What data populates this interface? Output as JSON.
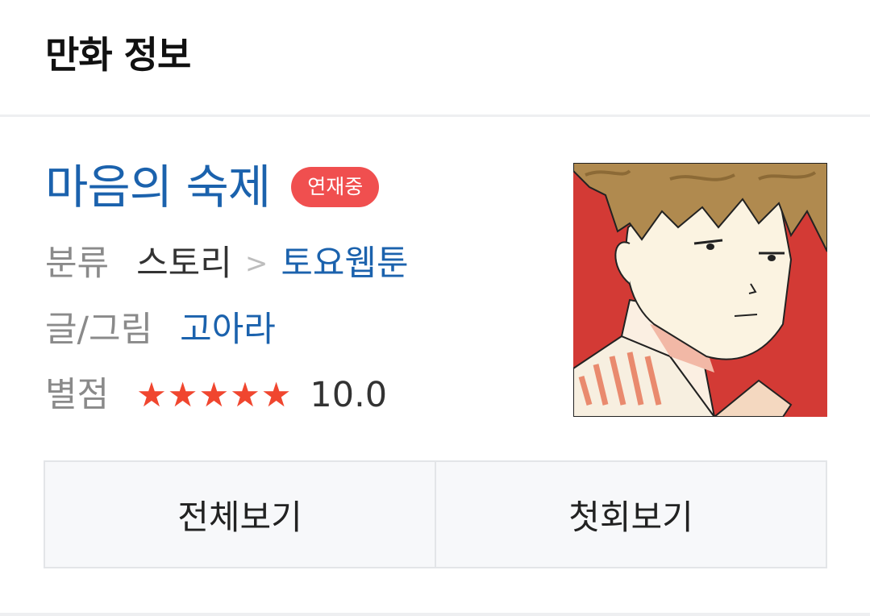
{
  "header": {
    "title": "만화 정보"
  },
  "comic": {
    "title": "마음의 숙제",
    "status": "연재중",
    "genre_label": "분류",
    "genre_main": "스토리",
    "genre_separator": ">",
    "genre_sub": "토요웹툰",
    "author_label": "글/그림",
    "author": "고아라",
    "rating_label": "별점",
    "rating": "10.0",
    "stars_filled": 5,
    "stars_total": 5,
    "thumbnail": "comic-cover-illustration"
  },
  "actions": {
    "view_all": "전체보기",
    "first_episode": "첫회보기"
  },
  "colors": {
    "title_blue": "#1b62ad",
    "badge_red": "#f04f4f",
    "star_red": "#f0462f",
    "label_gray": "#8a8a8a",
    "button_bg": "#f7f8fa",
    "thumbnail_bg": "#d33a35"
  }
}
